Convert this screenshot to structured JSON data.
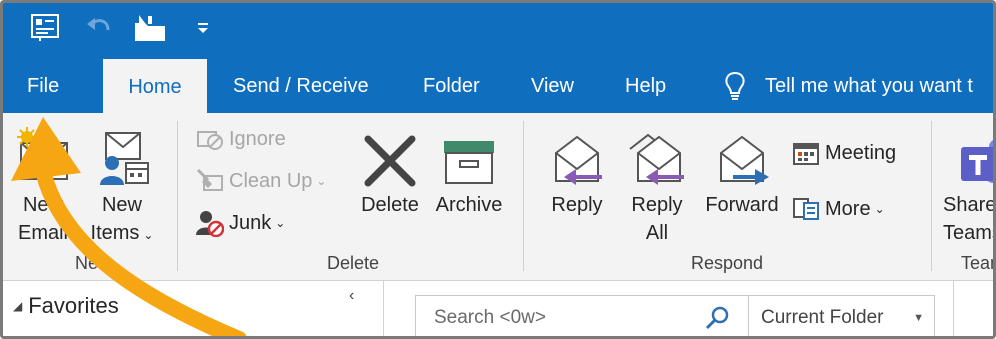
{
  "tabs": {
    "file": "File",
    "home": "Home",
    "send_receive": "Send / Receive",
    "folder": "Folder",
    "view": "View",
    "help": "Help",
    "tell_me": "Tell me what you want t"
  },
  "ribbon": {
    "new_email": [
      "New",
      "Email"
    ],
    "new_items": [
      "New",
      "Items"
    ],
    "ignore": "Ignore",
    "clean_up": "Clean Up",
    "junk": "Junk",
    "delete": "Delete",
    "archive": "Archive",
    "reply": "Reply",
    "reply_all": [
      "Reply",
      "All"
    ],
    "forward": "Forward",
    "meeting": "Meeting",
    "more": "More",
    "share_teams": [
      "Share",
      "Teams"
    ],
    "groups": {
      "new": "New",
      "delete": "Delete",
      "respond": "Respond",
      "teams": "Teams"
    }
  },
  "nav": {
    "favorites": "Favorites",
    "collapse_glyph": "‹"
  },
  "search": {
    "placeholder": "Search <0w>",
    "scope": "Current Folder"
  },
  "colors": {
    "brand": "#106ebe",
    "ribbon_bg": "#f3f3f3",
    "annotation_arrow": "#f5a612",
    "teams_purple": "#5b5fc7",
    "respond_purple": "#8a5bb4",
    "forward_blue": "#2d6fb5"
  }
}
